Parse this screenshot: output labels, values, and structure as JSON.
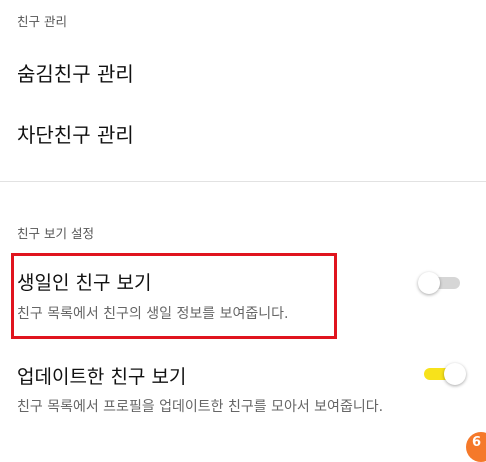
{
  "friend_management": {
    "header": "친구 관리",
    "items": [
      {
        "label": "숨김친구 관리"
      },
      {
        "label": "차단친구 관리"
      }
    ]
  },
  "friend_view_settings": {
    "header": "친구 보기 설정",
    "birthday": {
      "title": "생일인 친구 보기",
      "description": "친구 목록에서 친구의 생일 정보를 보여줍니다.",
      "enabled": false
    },
    "updated": {
      "title": "업데이트한 친구 보기",
      "description": "친구 목록에서 프로필을 업데이트한 친구를 모아서 보여줍니다.",
      "enabled": true
    }
  },
  "colors": {
    "accent_yellow": "#f7e21b",
    "highlight_red": "#e0141e",
    "fab_orange": "#f5792a"
  },
  "fab_glyph": "6"
}
